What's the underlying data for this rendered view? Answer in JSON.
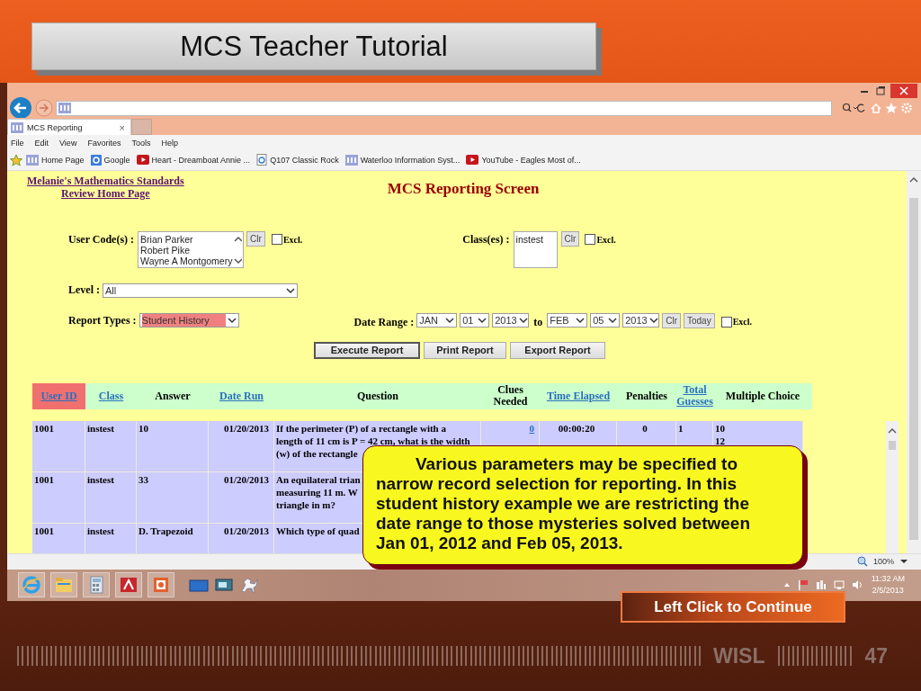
{
  "slide": {
    "title": "MCS Teacher Tutorial",
    "continue_button": "Left Click to Continue",
    "brand": "WISL",
    "page_number": "47"
  },
  "browser": {
    "tab": {
      "title": "MCS Reporting",
      "close": "×",
      "selected": true
    },
    "menu": [
      "File",
      "Edit",
      "View",
      "Favorites",
      "Tools",
      "Help"
    ],
    "favorites": [
      {
        "label": "Home Page",
        "kind": "site"
      },
      {
        "label": "Google",
        "kind": "google"
      },
      {
        "label": "Heart - Dreamboat Annie ...",
        "kind": "youtube"
      },
      {
        "label": "Q107 Classic Rock",
        "kind": "page"
      },
      {
        "label": "Waterloo Information Syst...",
        "kind": "site"
      },
      {
        "label": "YouTube - Eagles Most of...",
        "kind": "youtube"
      }
    ],
    "zoom": "100%"
  },
  "page": {
    "home_link": [
      "Melanie's Mathematics Standards",
      "Review Home Page"
    ],
    "heading": "MCS Reporting Screen",
    "user_codes": {
      "label": "User Code(s) :",
      "options": [
        "Brian Parker",
        "Robert Pike",
        "Wayne A Montgomery"
      ],
      "clear": "Clr",
      "exclude": {
        "label": "Excl.",
        "checked": false
      }
    },
    "classes": {
      "label": "Class(es) :",
      "options": [
        "instest"
      ],
      "clear": "Clr",
      "exclude": {
        "label": "Excl.",
        "checked": false
      }
    },
    "level": {
      "label": "Level :",
      "value": "All"
    },
    "report_type": {
      "label": "Report Types :",
      "value": "Student History"
    },
    "date_range": {
      "label": "Date Range :",
      "from": [
        "JAN",
        "01",
        "2013"
      ],
      "to_label": "to",
      "to": [
        "FEB",
        "05",
        "2013"
      ],
      "clear": "Clr",
      "today": "Today",
      "exclude": {
        "label": "Excl.",
        "checked": false
      }
    },
    "actions": [
      {
        "label": "Execute Report",
        "default": true
      },
      {
        "label": "Print Report",
        "default": false
      },
      {
        "label": "Export Report",
        "default": false
      }
    ]
  },
  "table": {
    "columns": [
      {
        "label": "User ID",
        "link": true,
        "sorted": true,
        "value_link": false
      },
      {
        "label": "Class",
        "link": true,
        "sorted": false,
        "value_link": false
      },
      {
        "label": "Answer",
        "link": false,
        "sorted": false,
        "value_link": false
      },
      {
        "label": "Date Run",
        "link": true,
        "sorted": false,
        "value_link": false
      },
      {
        "label": "Question",
        "link": false,
        "sorted": false,
        "value_link": false
      },
      {
        "label": "Clues Needed",
        "link": false,
        "sorted": false,
        "value_link": true
      },
      {
        "label": "Time Elapsed",
        "link": true,
        "sorted": false,
        "value_link": false
      },
      {
        "label": "Penalties",
        "link": false,
        "sorted": false,
        "value_link": false
      },
      {
        "label": "Total Guesses",
        "link": true,
        "sorted": false,
        "value_link": false
      },
      {
        "label": "Multiple Choice",
        "link": false,
        "sorted": false,
        "value_link": false
      }
    ],
    "rows": [
      {
        "cells": [
          "1001",
          "instest",
          "10",
          "01/20/2013",
          [
            "If the perimeter (P) of a rectangle with a",
            "length of 11 cm is P = 42 cm, what is the width",
            "(w) of the rectangle"
          ],
          "0",
          "00:00:20",
          "0",
          "1",
          [
            "10",
            "12"
          ]
        ]
      },
      {
        "cells": [
          "1001",
          "instest",
          "33",
          "01/20/2013",
          [
            "An equilateral trian",
            "measuring 11 m. W",
            "triangle in m?"
          ]
        ]
      },
      {
        "cells": [
          "1001",
          "instest",
          "D. Trapezoid",
          "01/20/2013",
          [
            "Which type of quad"
          ]
        ]
      }
    ]
  },
  "callout": "Various parameters may be specified to narrow record selection for reporting. In this student history example we are restricting the date range to those mysteries solved between Jan 01, 2012 and Feb 05, 2013.",
  "taskbar": {
    "time": "11:32 AM",
    "date": "2/5/2013"
  }
}
